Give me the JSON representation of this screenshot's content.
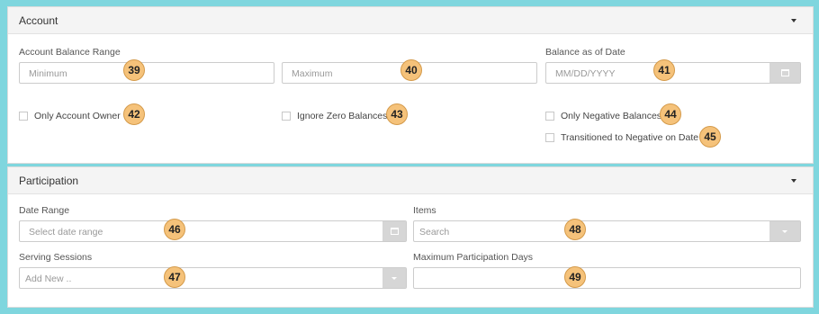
{
  "account": {
    "title": "Account",
    "balance_range_label": "Account Balance Range",
    "minimum_placeholder": "Minimum",
    "maximum_placeholder": "Maximum",
    "balance_date_label": "Balance as of Date",
    "date_placeholder": "MM/DD/YYYY",
    "checkboxes": {
      "only_account_owner": "Only Account Owner",
      "ignore_zero_balances": "Ignore Zero Balances",
      "only_negative_balances": "Only Negative Balances",
      "transitioned_negative": "Transitioned to Negative on Date"
    }
  },
  "participation": {
    "title": "Participation",
    "date_range_label": "Date Range",
    "date_range_placeholder": "Select date range",
    "items_label": "Items",
    "items_placeholder": "Search",
    "serving_sessions_label": "Serving Sessions",
    "serving_sessions_placeholder": "Add New ..",
    "max_days_label": "Maximum Participation Days",
    "max_days_value": ""
  },
  "badges": {
    "b39": "39",
    "b40": "40",
    "b41": "41",
    "b42": "42",
    "b43": "43",
    "b44": "44",
    "b45": "45",
    "b46": "46",
    "b47": "47",
    "b48": "48",
    "b49": "49"
  },
  "colors": {
    "background": "#7fd6de",
    "badge": "#f5c27a",
    "addon": "#d6d6d6"
  }
}
